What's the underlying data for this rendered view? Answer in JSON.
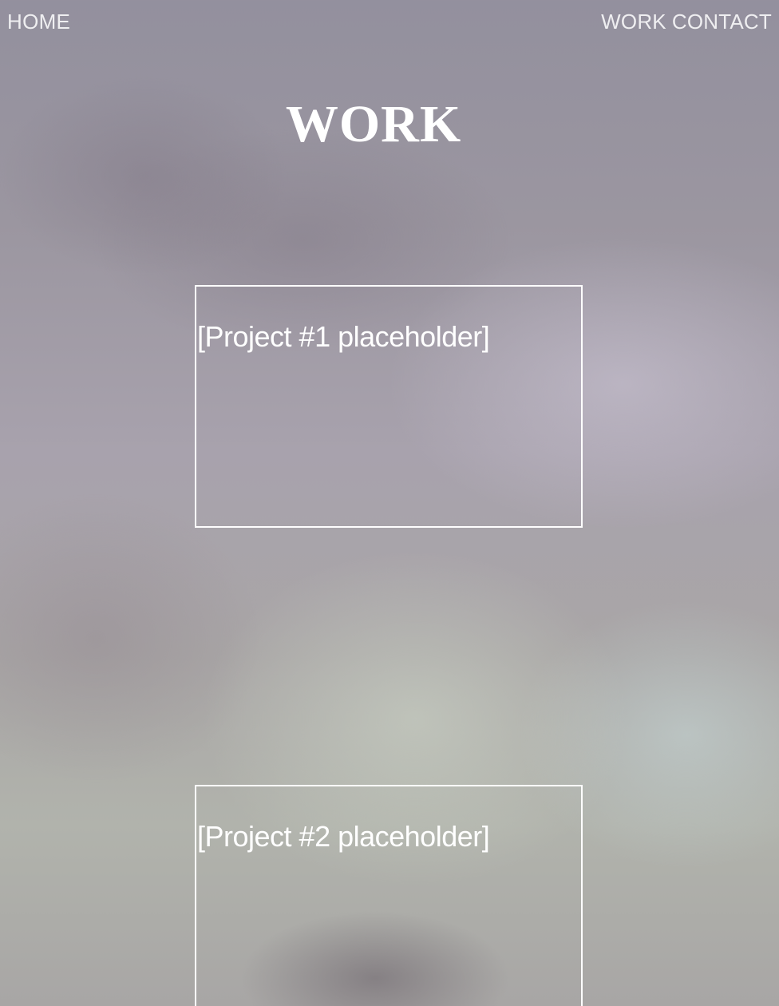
{
  "nav": {
    "home_label": "HOME",
    "work_label": "WORK",
    "contact_label": "CONTACT"
  },
  "page": {
    "title": "WORK"
  },
  "projects": [
    {
      "label": "[Project #1 placeholder]"
    },
    {
      "label": "[Project #2 placeholder]"
    }
  ],
  "colors": {
    "text": "#ffffff",
    "border": "#ffffff"
  }
}
